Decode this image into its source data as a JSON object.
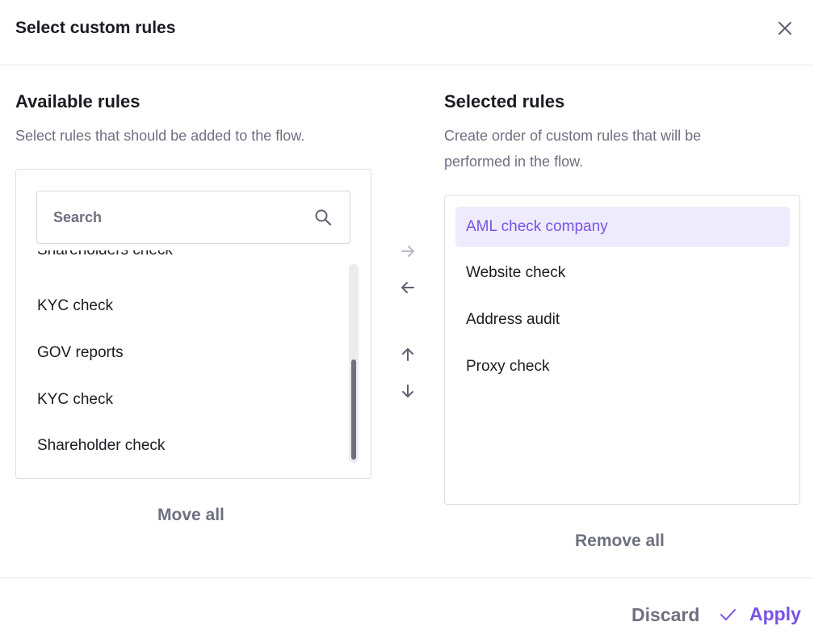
{
  "dialog": {
    "title": "Select custom rules"
  },
  "available": {
    "title": "Available rules",
    "description": "Select rules that should be added to the flow.",
    "search_placeholder": "Search",
    "items": [
      {
        "label": "Shareholders check"
      },
      {
        "label": "KYC check"
      },
      {
        "label": "GOV reports"
      },
      {
        "label": "KYC check"
      },
      {
        "label": "Shareholder check"
      }
    ],
    "move_all_label": "Move all"
  },
  "selected": {
    "title": "Selected rules",
    "description_line1": "Create order of custom rules that will be",
    "description_line2": "performed in the flow.",
    "items": [
      {
        "label": "AML check company",
        "active": true
      },
      {
        "label": "Website check",
        "active": false
      },
      {
        "label": "Address audit",
        "active": false
      },
      {
        "label": "Proxy check",
        "active": false
      }
    ],
    "remove_all_label": "Remove all"
  },
  "controls": {
    "move_right_icon": "arrow-right-icon",
    "move_left_icon": "arrow-left-icon",
    "move_up_icon": "arrow-up-icon",
    "move_down_icon": "arrow-down-icon"
  },
  "footer": {
    "discard_label": "Discard",
    "apply_label": "Apply"
  },
  "colors": {
    "accent": "#7a52e8",
    "selected_bg": "#eeebfc",
    "muted_text": "#6e7080",
    "disabled_arrow": "#b9b9c4"
  }
}
